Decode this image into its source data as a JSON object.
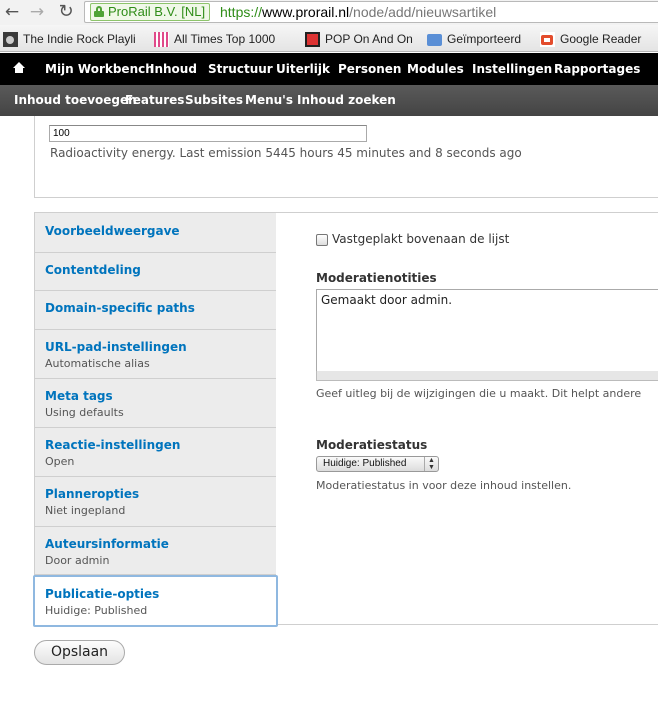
{
  "browser": {
    "ev_label": "ProRail B.V. [NL]",
    "url_scheme": "https://",
    "url_host": "www.prorail.nl",
    "url_path": "/node/add/nieuwsartikel"
  },
  "bookmarks": [
    {
      "label": "The Indie Rock Playlis",
      "icon": "indie-icon"
    },
    {
      "label": "All Times Top 1000",
      "icon": "tracks-icon"
    },
    {
      "label": "POP On And On",
      "icon": "pop-icon"
    },
    {
      "label": "Geïmporteerd",
      "icon": "folder-icon"
    },
    {
      "label": "Google Reader",
      "icon": "reader-icon"
    }
  ],
  "toolbar": {
    "home_icon": "home-icon",
    "items": [
      "Mijn Workbench",
      "Inhoud",
      "Structuur",
      "Uiterlijk",
      "Personen",
      "Modules",
      "Instellingen",
      "Rapportages"
    ]
  },
  "shortcuts": {
    "items": [
      "Inhoud toevoegen",
      "Features",
      "Subsites",
      "Menu's",
      "Inhoud zoeken"
    ]
  },
  "radioactivity": {
    "value": "100",
    "description": "Radioactivity energy. Last emission 5445 hours 45 minutes and 8 seconds ago"
  },
  "vertical_tabs": [
    {
      "title": "Voorbeeldweergave",
      "summary": ""
    },
    {
      "title": "Contentdeling",
      "summary": ""
    },
    {
      "title": "Domain-specific paths",
      "summary": ""
    },
    {
      "title": "URL-pad-instellingen",
      "summary": "Automatische alias"
    },
    {
      "title": "Meta tags",
      "summary": "Using defaults"
    },
    {
      "title": "Reactie-instellingen",
      "summary": "Open"
    },
    {
      "title": "Planneropties",
      "summary": "Niet ingepland"
    },
    {
      "title": "Auteursinformatie",
      "summary": "Door admin"
    },
    {
      "title": "Publicatie-opties",
      "summary": "Huidige: Published"
    }
  ],
  "pane": {
    "sticky_label": "Vastgeplakt bovenaan de lijst",
    "notes_label": "Moderatienotities",
    "notes_value": "Gemaakt door admin.",
    "notes_description": "Geef uitleg bij de wijzigingen die u maakt. Dit helpt andere",
    "status_label": "Moderatiestatus",
    "status_value": "Huidige: Published",
    "status_description": "Moderatiestatus in voor deze inhoud instellen."
  },
  "actions": {
    "save_label": "Opslaan"
  }
}
